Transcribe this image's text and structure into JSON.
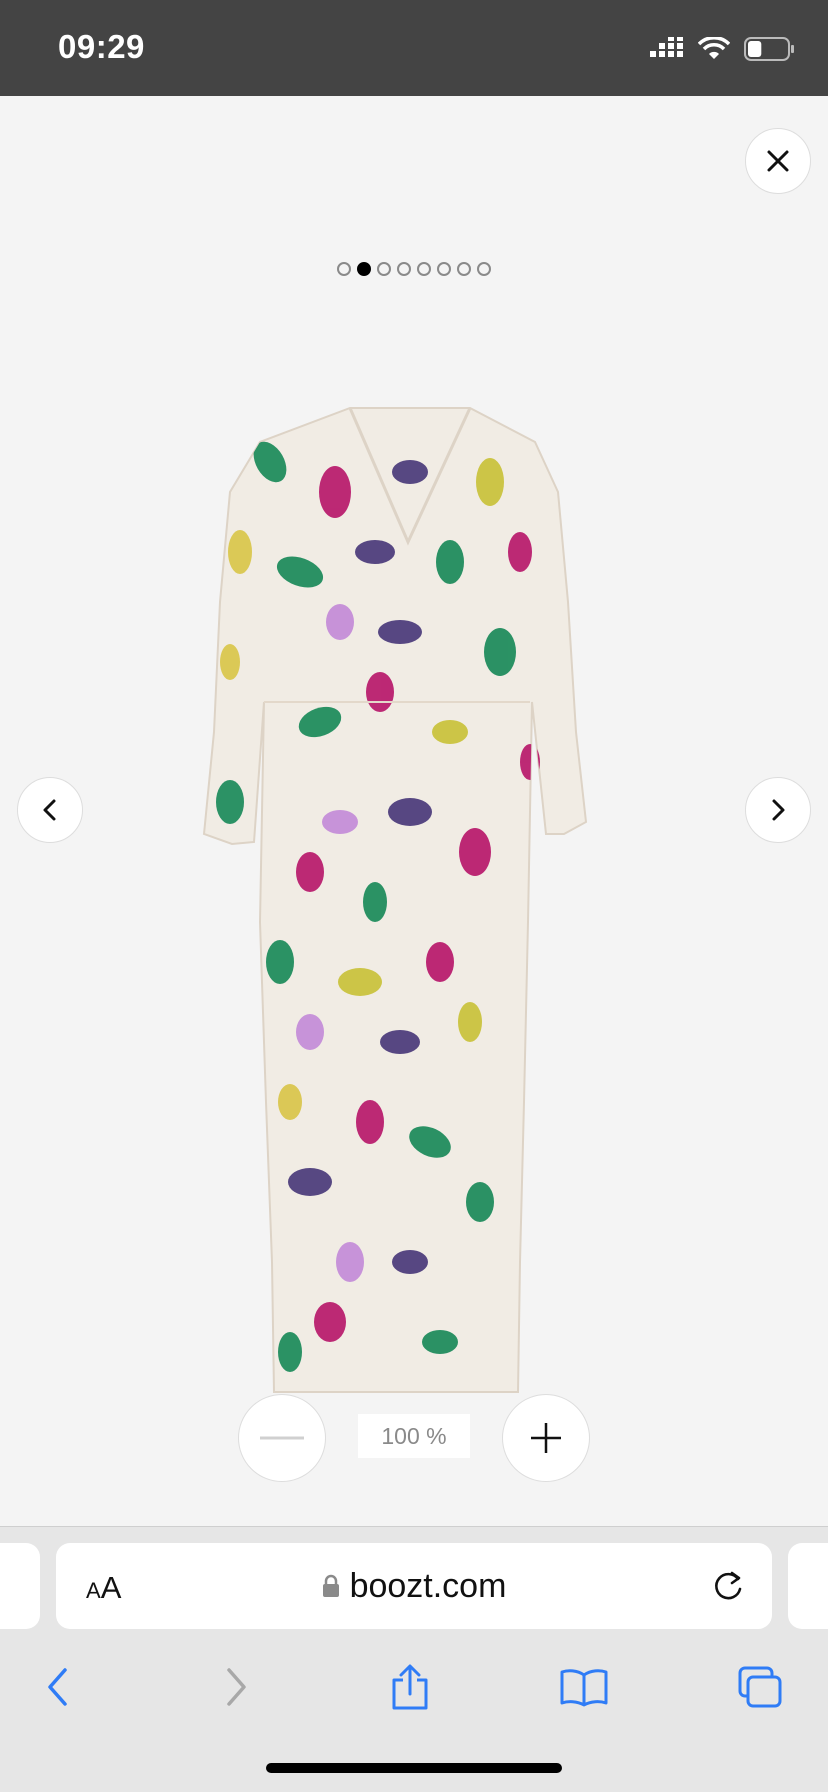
{
  "status_bar": {
    "time": "09:29",
    "battery_level": 0.35
  },
  "gallery": {
    "image_count": 8,
    "active_index": 1
  },
  "icons": {
    "close": "close-icon",
    "prev": "chevron-left-icon",
    "next": "chevron-right-icon",
    "zoom_out": "minus-icon",
    "zoom_in": "plus-icon"
  },
  "zoom": {
    "value": "100 %"
  },
  "browser": {
    "text_size_label_small": "A",
    "text_size_label_large": "A",
    "url": "boozt.com"
  },
  "colors": {
    "status_bar": "#444444",
    "viewer_bg": "#f4f4f4",
    "safari_blue": "#2f7cf6",
    "active_dot": "#000000"
  }
}
